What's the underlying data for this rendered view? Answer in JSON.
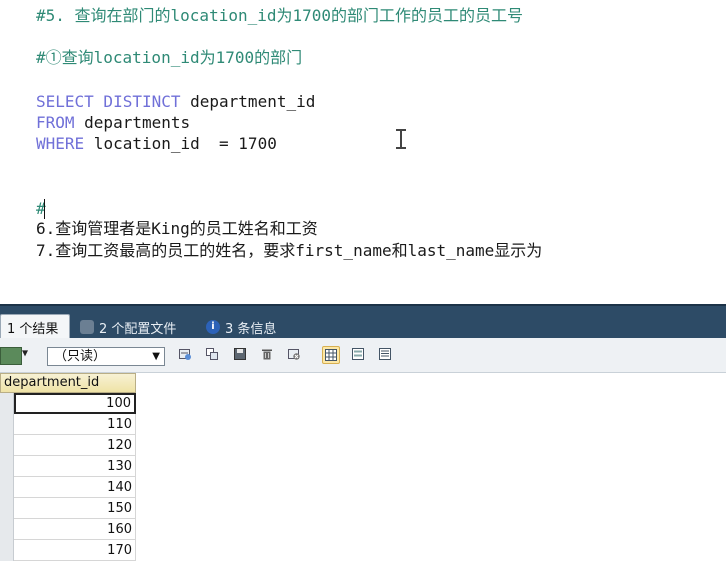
{
  "editor": {
    "comment_q5": "#5. 查询在部门的location_id为1700的部门工作的员工的员工号",
    "comment_step1": "#①查询location_id为1700的部门",
    "sql": {
      "kw_select": "SELECT DISTINCT",
      "select_rest": " department_id",
      "kw_from": "FROM",
      "from_rest": " departments",
      "kw_where": "WHERE",
      "where_rest": " location_id  = 1700"
    },
    "hash_line": "#",
    "line_q6": "6.查询管理者是King的员工姓名和工资",
    "line_q7": "7.查询工资最高的员工的姓名，要求first_name和last_name显示为"
  },
  "tabs": [
    {
      "label": "1 个结果",
      "icon": "result-icon"
    },
    {
      "label": "2 个配置文件",
      "icon": "profile-icon"
    },
    {
      "label": "3 条信息",
      "icon": "info-icon"
    }
  ],
  "toolbar": {
    "mode_select_value": "（只读）"
  },
  "grid": {
    "columns": [
      "department_id"
    ],
    "rows": [
      "100",
      "110",
      "120",
      "130",
      "140",
      "150",
      "160",
      "170"
    ]
  }
}
